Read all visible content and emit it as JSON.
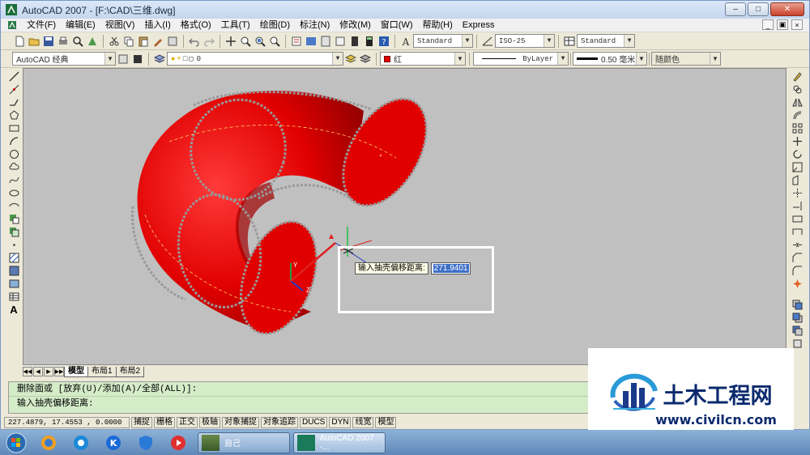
{
  "window": {
    "title": "AutoCAD 2007 - [F:\\CAD\\三维.dwg]"
  },
  "menu": [
    "文件(F)",
    "编辑(E)",
    "视图(V)",
    "插入(I)",
    "格式(O)",
    "工具(T)",
    "绘图(D)",
    "标注(N)",
    "修改(M)",
    "窗口(W)",
    "帮助(H)",
    "Express"
  ],
  "toolbar": {
    "text_style": "Standard",
    "dim_style": "ISO-25",
    "table_style": "Standard",
    "workspace": "AutoCAD 经典",
    "layer": "0",
    "color": "红",
    "linetype": "ByLayer",
    "lineweight": "0.50 毫米",
    "plotstyle": "随颜色"
  },
  "dynamic_input": {
    "label": "输入抽壳偏移距离:",
    "value": "271.9401"
  },
  "ucs": {
    "y_label": "Y",
    "z_label": "Z"
  },
  "tabs": {
    "items": [
      "模型",
      "布局1",
      "布局2"
    ]
  },
  "command": {
    "line1": "删除面或 [放弃(U)/添加(A)/全部(ALL)]:",
    "line2": "输入抽壳偏移距离:"
  },
  "status": {
    "coords": "227.4879,  17.4553  , 0.0000",
    "buttons": [
      "捕捉",
      "栅格",
      "正交",
      "极轴",
      "对象捕捉",
      "对象追踪",
      "DUCS",
      "DYN",
      "线宽",
      "模型"
    ]
  },
  "watermark": {
    "name": "土木工程网",
    "url": "www.civilcn.com"
  },
  "taskbar": {
    "tasks": [
      "自己",
      "AutoCAD 2007 -..."
    ]
  },
  "colors": {
    "solid": "#e00000",
    "canvas": "#c0c0c0",
    "cmd_bg": "#d4ecc8"
  }
}
